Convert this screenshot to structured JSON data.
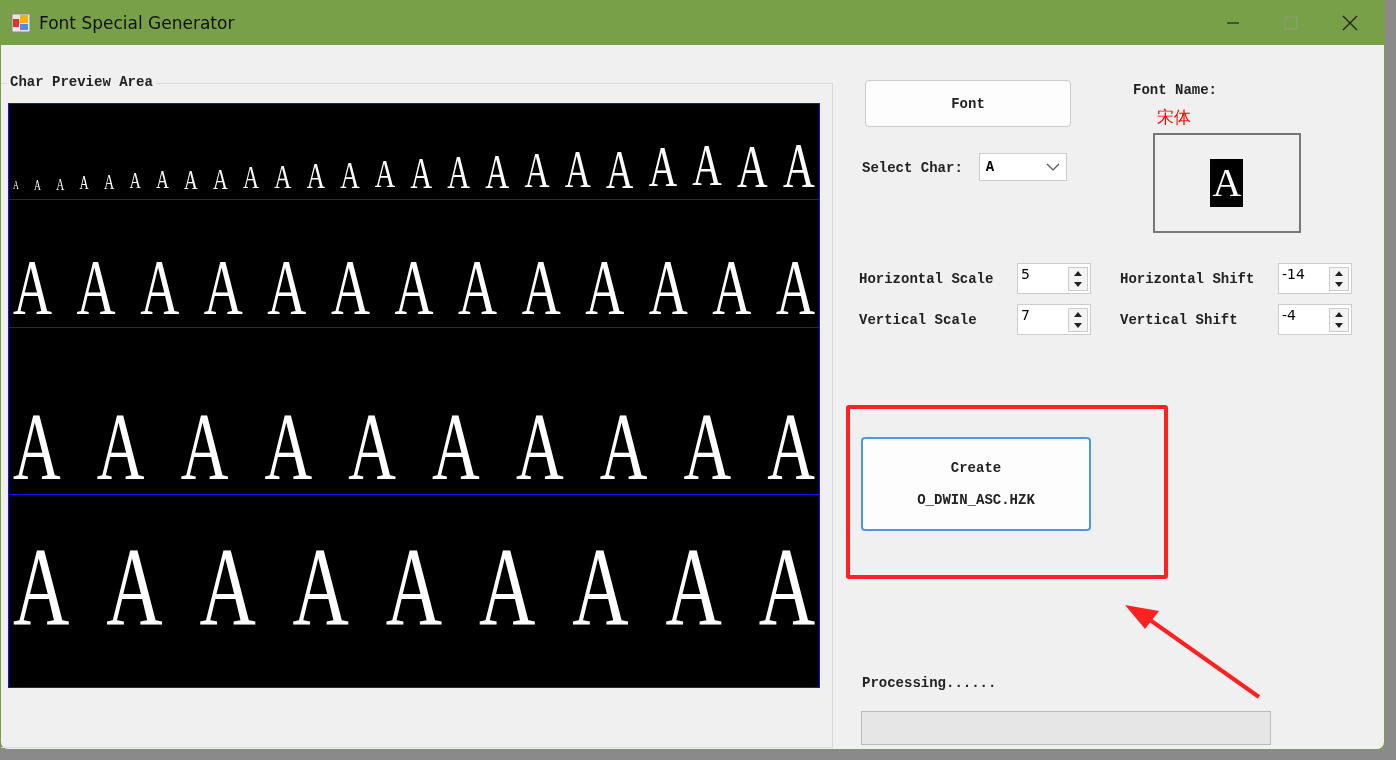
{
  "window": {
    "title": "Font Special Generator"
  },
  "preview": {
    "title": "Char Preview Area",
    "rows": [
      {
        "glyphs": [
          "A",
          "A",
          "A",
          "A",
          "A",
          "A",
          "A",
          "A",
          "A",
          "A",
          "A",
          "A",
          "A",
          "A",
          "A",
          "A",
          "A",
          "A",
          "A",
          "A",
          "A",
          "A",
          "A",
          "A"
        ]
      },
      {
        "glyphs": [
          "A",
          "A",
          "A",
          "A",
          "A",
          "A",
          "A",
          "A",
          "A",
          "A",
          "A",
          "A",
          "A"
        ]
      },
      {
        "glyphs": [
          "A",
          "A",
          "A",
          "A",
          "A",
          "A",
          "A",
          "A",
          "A",
          "A"
        ]
      },
      {
        "glyphs": [
          "A",
          "A",
          "A",
          "A",
          "A",
          "A",
          "A",
          "A",
          "A"
        ]
      }
    ]
  },
  "font_button": "Font",
  "font_name": {
    "label": "Font Name:",
    "value": "宋体"
  },
  "select_char": {
    "label": "Select Char:",
    "value": "A"
  },
  "char_sample": "A",
  "spinners": [
    {
      "label": "Horizontal Scale",
      "value": "5"
    },
    {
      "label": "Horizontal Shift",
      "value": "-14"
    },
    {
      "label": "Vertical Scale",
      "value": "7"
    },
    {
      "label": "Vertical Shift",
      "value": "-4"
    }
  ],
  "create_button": {
    "lines": [
      "Create",
      "O_DWIN_ASC.HZK"
    ]
  },
  "status": "Processing......",
  "progress": {
    "level": 0
  }
}
